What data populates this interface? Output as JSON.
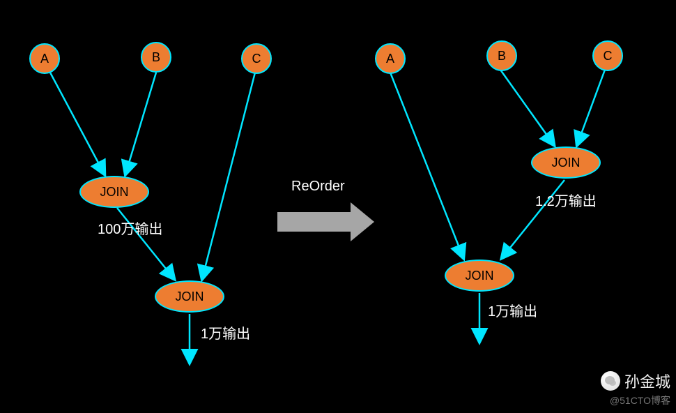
{
  "left": {
    "nodes": {
      "A": "A",
      "B": "B",
      "C": "C"
    },
    "join1": "JOIN",
    "join1_out": "100万输出",
    "join2": "JOIN",
    "join2_out": "1万输出"
  },
  "center_label": "ReOrder",
  "right": {
    "nodes": {
      "A": "A",
      "B": "B",
      "C": "C"
    },
    "join1": "JOIN",
    "join1_out": "1.2万输出",
    "join2": "JOIN",
    "join2_out": "1万输出"
  },
  "watermark": {
    "name": "孙金城",
    "sub": "@51CTO博客"
  },
  "chart_data": {
    "type": "diagram",
    "title": "Join ReOrder optimization",
    "before": {
      "joins": [
        {
          "inputs": [
            "A",
            "B"
          ],
          "output_rows_label": "100万输出",
          "output_rows_approx": 1000000
        },
        {
          "inputs": [
            "JOIN(A,B)",
            "C"
          ],
          "output_rows_label": "1万输出",
          "output_rows_approx": 10000
        }
      ]
    },
    "after": {
      "joins": [
        {
          "inputs": [
            "B",
            "C"
          ],
          "output_rows_label": "1.2万输出",
          "output_rows_approx": 12000
        },
        {
          "inputs": [
            "A",
            "JOIN(B,C)"
          ],
          "output_rows_label": "1万输出",
          "output_rows_approx": 10000
        }
      ]
    }
  }
}
